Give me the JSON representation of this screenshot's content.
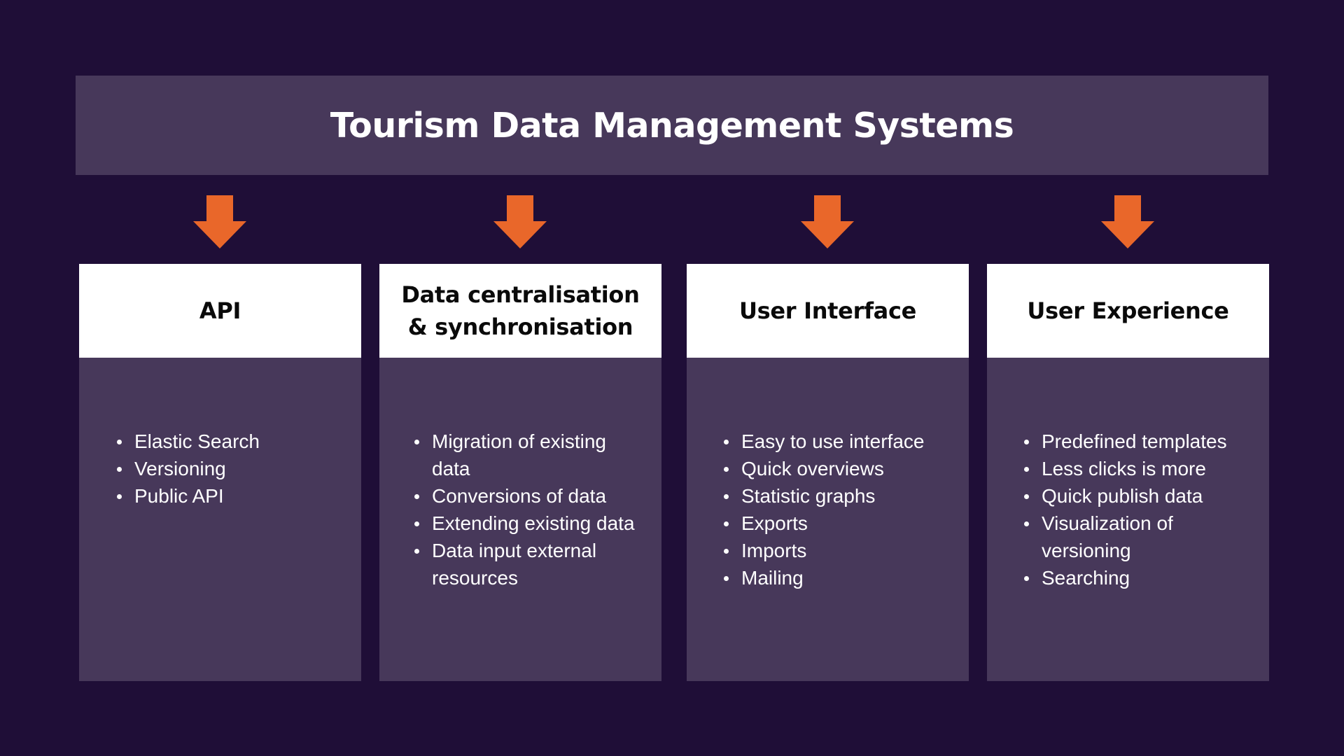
{
  "title": "Tourism Data Management Systems",
  "colors": {
    "background": "#1f0e37",
    "panel": "#47385a",
    "arrow": "#e9672a",
    "header_bg": "#ffffff"
  },
  "arrow_icon": "down-arrow-icon",
  "cards": [
    {
      "title": "API",
      "items": [
        "Elastic Search",
        "Versioning",
        "Public API"
      ]
    },
    {
      "title": "Data centralisation & synchronisation",
      "items": [
        "Migration of existing data",
        "Conversions of data",
        "Extending existing data",
        "Data input external resources"
      ]
    },
    {
      "title": "User Interface",
      "items": [
        "Easy to use interface",
        "Quick overviews",
        "Statistic graphs",
        "Exports",
        "Imports",
        "Mailing"
      ]
    },
    {
      "title": "User Experience",
      "items": [
        "Predefined templates",
        "Less clicks is more",
        "Quick publish data",
        "Visualization of versioning",
        "Searching"
      ]
    }
  ]
}
